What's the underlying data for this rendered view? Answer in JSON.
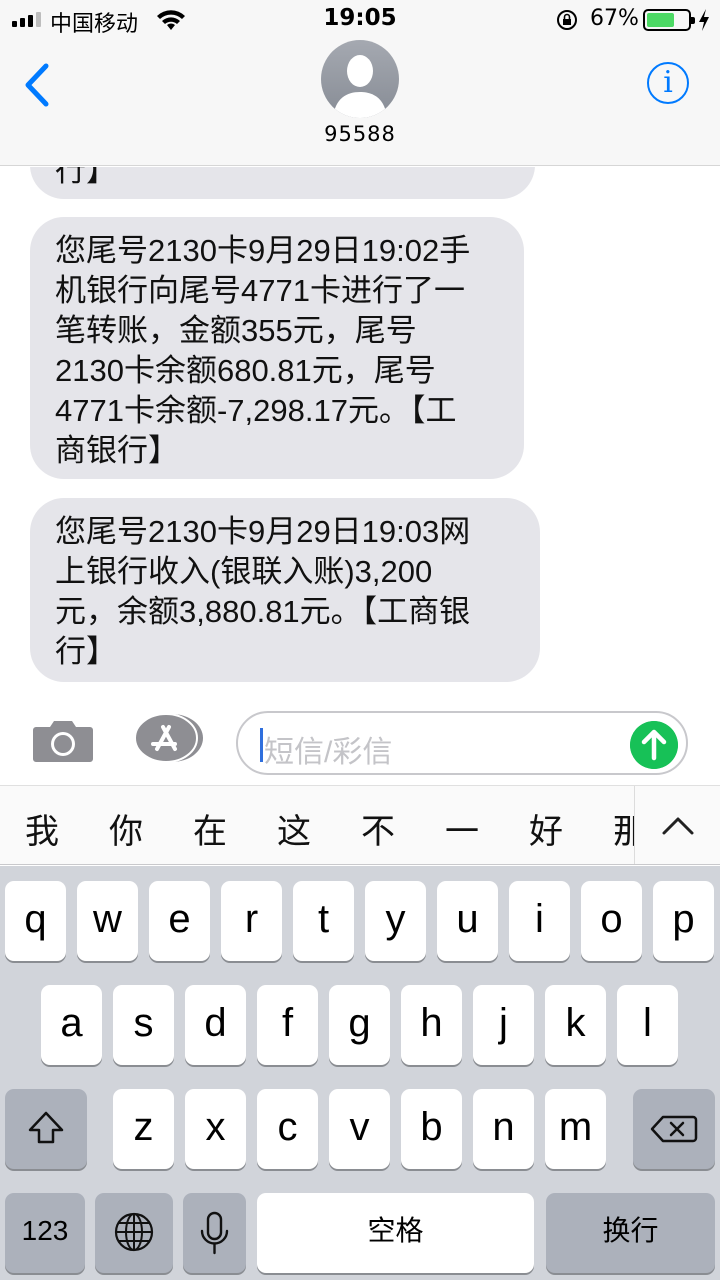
{
  "status_bar": {
    "carrier": "中国移动",
    "time": "19:05",
    "battery_percent": "67%",
    "battery_level": 0.67,
    "icons": [
      "signal-bars-icon",
      "wifi-icon",
      "orientation-lock-icon",
      "battery-icon",
      "charging-bolt-icon"
    ]
  },
  "header": {
    "contact": "95588",
    "back_icon": "chevron-left-icon",
    "info_icon": "info-circle-icon",
    "info_glyph": "i"
  },
  "messages": [
    {
      "lines": [
        "行】"
      ]
    },
    {
      "lines": [
        "您尾号2130卡9月29日19:02手",
        "机银行向尾号4771卡进行了一",
        "笔转账，金额355元，尾号",
        "2130卡余额680.81元，尾号",
        "4771卡余额-7,298.17元。【工",
        "商银行】"
      ]
    },
    {
      "lines": [
        "您尾号2130卡9月29日19:03网",
        "上银行收入(银联入账)3,200",
        "元，余额3,880.81元。【工商银",
        "行】"
      ]
    }
  ],
  "input_bar": {
    "placeholder": "短信/彩信",
    "camera_icon": "camera-icon",
    "apps_icon": "app-store-icon",
    "send_icon": "send-arrow-up-icon"
  },
  "candidates": [
    "我",
    "你",
    "在",
    "这",
    "不",
    "一",
    "好",
    "那"
  ],
  "candidate_toggle_icon": "chevron-up-icon",
  "keyboard": {
    "row1": [
      "q",
      "w",
      "e",
      "r",
      "t",
      "y",
      "u",
      "i",
      "o",
      "p"
    ],
    "row2": [
      "a",
      "s",
      "d",
      "f",
      "g",
      "h",
      "j",
      "k",
      "l"
    ],
    "row3": [
      "z",
      "x",
      "c",
      "v",
      "b",
      "n",
      "m"
    ],
    "shift_icon": "shift-icon",
    "delete_icon": "delete-icon",
    "numbers_label": "123",
    "globe_icon": "globe-icon",
    "mic_icon": "microphone-icon",
    "space_label": "空格",
    "return_label": "换行"
  }
}
